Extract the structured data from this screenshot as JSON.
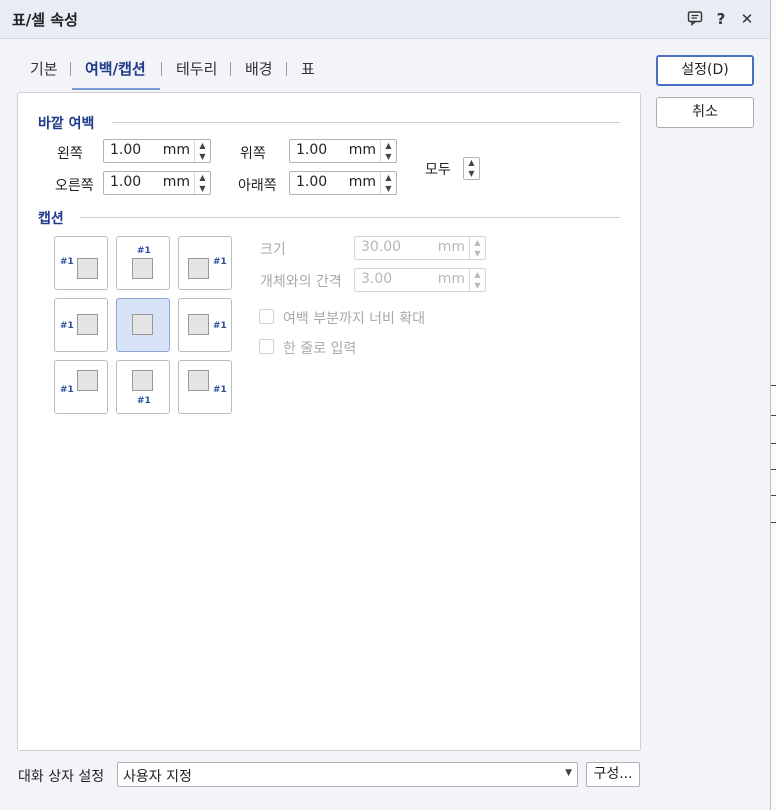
{
  "window": {
    "title": "표/셀 속성",
    "icons": [
      "comment-icon",
      "help-icon",
      "close-icon"
    ],
    "help_glyph": "?",
    "close_glyph": "✕"
  },
  "tabs": [
    {
      "label": "기본",
      "active": false
    },
    {
      "label": "여백/캡션",
      "active": true
    },
    {
      "label": "테두리",
      "active": false
    },
    {
      "label": "배경",
      "active": false
    },
    {
      "label": "표",
      "active": false
    }
  ],
  "outer_margin": {
    "section_label": "바깥 여백",
    "left": {
      "label": "왼쪽",
      "value": "1.00",
      "unit": "mm"
    },
    "top": {
      "label": "위쪽",
      "value": "1.00",
      "unit": "mm"
    },
    "right": {
      "label": "오른쪽",
      "value": "1.00",
      "unit": "mm"
    },
    "bottom": {
      "label": "아래쪽",
      "value": "1.00",
      "unit": "mm"
    },
    "all_label": "모두"
  },
  "caption": {
    "section_label": "캡션",
    "tag": "#1",
    "selected_position": "none",
    "size": {
      "label": "크기",
      "value": "30.00",
      "unit": "mm",
      "enabled": false
    },
    "gap": {
      "label": "개체와의 간격",
      "value": "3.00",
      "unit": "mm",
      "enabled": false
    },
    "extend_width": {
      "label": "여백 부분까지 너비 확대",
      "checked": false,
      "enabled": false
    },
    "single_line": {
      "label": "한 줄로 입력",
      "checked": false,
      "enabled": false
    }
  },
  "buttons": {
    "ok": "설정(D)",
    "cancel": "취소",
    "configure": "구성..."
  },
  "dialog_settings": {
    "label": "대화 상자 설정",
    "value": "사용자 지정"
  },
  "colors": {
    "accent": "#1e3a8a",
    "selected_bg": "#d9e3f8",
    "titlebar_bg": "#e8ecf4"
  }
}
